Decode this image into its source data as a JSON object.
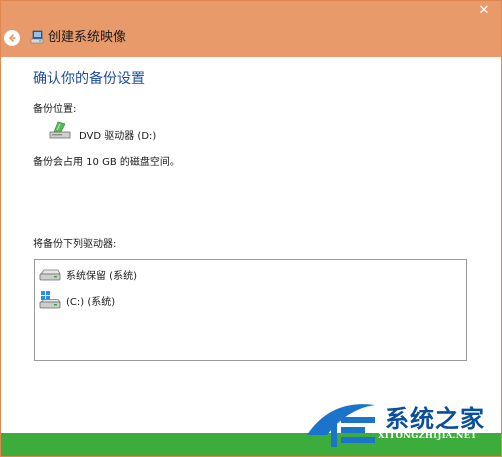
{
  "window": {
    "title": "创建系统映像",
    "close_glyph": "✕",
    "accent_color": "#e99a6b",
    "back_icon": "back-arrow-icon",
    "app_icon": "system-image-icon"
  },
  "main": {
    "heading": "确认你的备份设置",
    "location_label": "备份位置:",
    "location_value": "DVD 驱动器 (D:)",
    "location_icon": "dvd-drive-icon",
    "space_note": "备份会占用 10 GB 的磁盘空间。",
    "drives_label": "将备份下列驱动器:",
    "drives": [
      {
        "label": "系统保留 (系统)",
        "icon": "hard-drive-icon"
      },
      {
        "label": "(C:) (系统)",
        "icon": "windows-drive-icon"
      }
    ]
  },
  "watermark": {
    "text": "系统之家",
    "url": "XITONGZHIJIA.NET"
  }
}
